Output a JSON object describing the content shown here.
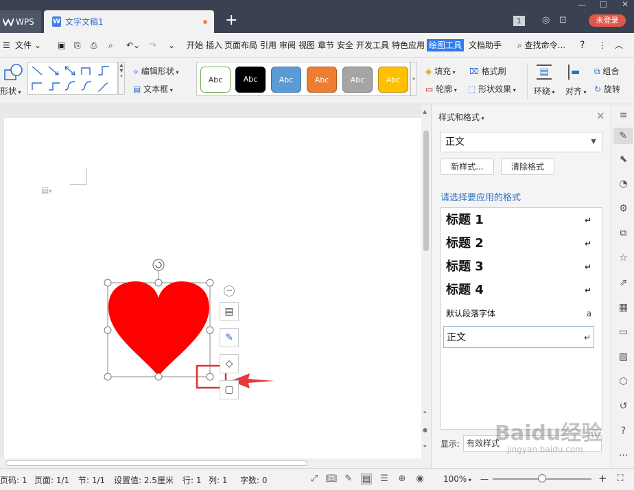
{
  "titlebar": {
    "app_tab": "WPS",
    "doc_tab": "文字文稿1",
    "new_tab": "+",
    "badge_num": "1",
    "login": "未登录"
  },
  "menu": {
    "file": "文件",
    "items": [
      "开始",
      "插入",
      "页面布局",
      "引用",
      "审阅",
      "视图",
      "章节",
      "安全",
      "开发工具",
      "特色应用",
      "绘图工具",
      "文档助手"
    ],
    "active": "绘图工具",
    "search": "查找命令...",
    "help": "?"
  },
  "ribbon": {
    "shape_label": "形状",
    "edit_shape": "编辑形状",
    "text_box": "文本框",
    "abc": "Abc",
    "fill": "填充",
    "outline": "轮廓",
    "format_painter": "格式刷",
    "shape_effects": "形状效果",
    "wrap": "环绕",
    "align": "对齐",
    "group": "组合",
    "rotate": "旋转",
    "style_colors": [
      "#ffffff",
      "#000000",
      "#5b9bd5",
      "#ed7d31",
      "#a5a5a5",
      "#ffc000"
    ]
  },
  "panel": {
    "title": "样式和格式",
    "current_style": "正文",
    "new_style": "新样式...",
    "clear_format": "清除格式",
    "prompt": "请选择要应用的格式",
    "styles": [
      {
        "label": "标题  1",
        "mark": "↵"
      },
      {
        "label": "标题  2",
        "mark": "↵"
      },
      {
        "label": "标题  3",
        "mark": "↵"
      },
      {
        "label": "标题  4",
        "mark": "↵"
      },
      {
        "label": "默认段落字体",
        "mark": "a"
      },
      {
        "label": "正文",
        "mark": "↵"
      }
    ],
    "show_label": "显示:",
    "show_value": "有效样式"
  },
  "status": {
    "page_num": "页码: 1",
    "pages": "页面: 1/1",
    "section": "节: 1/1",
    "setting": "设置值: 2.5厘米",
    "row": "行: 1",
    "col": "列: 1",
    "words": "字数: 0",
    "zoom": "100%",
    "zoom_minus": "—",
    "zoom_plus": "+",
    "zoom_level": 0.5
  },
  "shape": {
    "fill": "#ff0000",
    "highlight": "#e03030"
  },
  "watermark": {
    "main": "Baidu经验",
    "sub": "jingyan.baidu.com"
  }
}
